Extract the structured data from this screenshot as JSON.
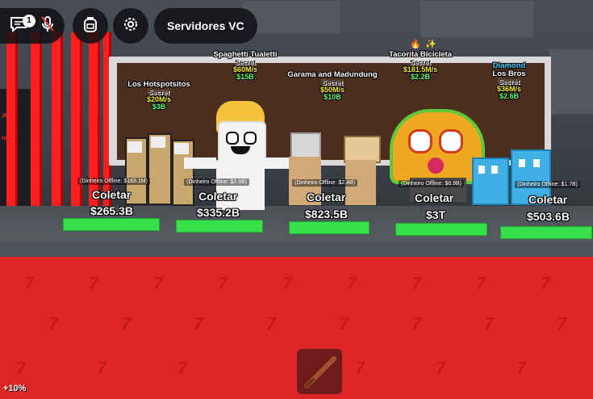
{
  "hud": {
    "chat_badge": "1",
    "servers_label": "Servidores VC",
    "boost_label": "+10%"
  },
  "left_sign": {
    "line1": "JOGO",
    "line2": "ro"
  },
  "brainrots": [
    {
      "name": "Los Hotspotsitos",
      "rarity": "Secret",
      "rate": "$20M/s",
      "price": "$3B",
      "offline": "(Dinheiro Offline: $183.1M)",
      "collect": "Coletar",
      "amount": "$265.3B",
      "tag": ""
    },
    {
      "name": "Spaghetti Tualetti",
      "rarity": "Secret",
      "rate": "$60M/s",
      "price": "$15B",
      "offline": "(Dinheiro Offline: $2.9B)",
      "collect": "Coletar",
      "amount": "$335.2B",
      "tag": ""
    },
    {
      "name": "Garama and Madundung",
      "rarity": "Secret",
      "rate": "$50M/s",
      "price": "$10B",
      "offline": "(Dinheiro Offline: $2.4B)",
      "collect": "Coletar",
      "amount": "$823.5B",
      "tag": ""
    },
    {
      "name": "Tacorita Bicicleta",
      "rarity": "Secret",
      "rate": "$181.5M/s",
      "price": "$2.2B",
      "offline": "(Dinheiro Offline: $8.9B)",
      "collect": "Coletar",
      "amount": "$3T",
      "tag": ""
    },
    {
      "name": "Los Bros",
      "rarity": "Secret",
      "rate": "$36M/s",
      "price": "$2.6B",
      "offline": "(Dinheiro Offline: $1.7B)",
      "collect": "Coletar",
      "amount": "$503.6B",
      "tag": "Diamond"
    }
  ],
  "icons": {
    "chat": "chat-icon",
    "mic": "microphone-muted-icon",
    "backpack": "backpack-icon",
    "settings": "gear-icon",
    "tool": "baseball-bat-icon"
  },
  "colors": {
    "floor": "#e02525",
    "pad": "#35e04a",
    "rate": "#f6f000",
    "price": "#5bff5b",
    "diamond": "#3fd5ff"
  }
}
